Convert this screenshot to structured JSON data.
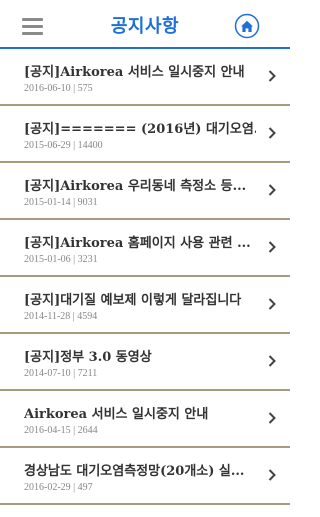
{
  "header": {
    "title": "공지사항",
    "menu_icon": "hamburger-menu-icon",
    "home_icon": "home-icon",
    "accent_color": "#1e6fd9"
  },
  "notices": [
    {
      "title": "[공지]Airkorea 서비스 일시중지 안내",
      "meta": "2016-06-10 | 575"
    },
    {
      "title": "[공지]======= (2016년) 대기오염...",
      "meta": "2015-06-29 | 14400"
    },
    {
      "title": "[공지]Airkorea 우리동네 측정소 등...",
      "meta": "2015-01-14 | 9031"
    },
    {
      "title": "[공지]Airkorea 홈페이지 사용 관련 ...",
      "meta": "2015-01-06 | 3231"
    },
    {
      "title": "[공지]대기질 예보제 이렇게 달라집니다",
      "meta": "2014-11-28 | 4594"
    },
    {
      "title": "[공지]정부 3.0 동영상",
      "meta": "2014-07-10 | 7211"
    },
    {
      "title": "Airkorea 서비스 일시중지 안내",
      "meta": "2016-04-15 | 2644"
    },
    {
      "title": "경상남도 대기오염측정망(20개소) 실...",
      "meta": "2016-02-29 | 497"
    }
  ]
}
